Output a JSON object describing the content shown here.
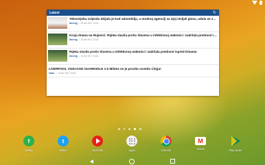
{
  "widget": {
    "title": "Latest",
    "items": [
      {
        "title": "Televizijska zvijezda Skijala je kod udomitelja, u modnoj agenciji za njoj stvljali glavu, adula se za grofa...",
        "source": "Dnevnjj",
        "time": "19 Avr 2017 13:24"
      },
      {
        "title": "Kroja drama na Rujevici: Rijeka slavila protiv Slavena u infektivnoj utakmici i zadržala prednost ispred Dinama",
        "source": "Dnevnjj",
        "time": "19 Avr 2017 13:24"
      },
      {
        "title": "Rijeka slavila protiv Slavena u infektivnoj utakmici i zadržala prednost ispred Dinama",
        "source": "Dnevnjj",
        "time": "19 Avr 2017 13:24"
      },
      {
        "title": "LIVERPOOL VODI KOD GUARDIOLE 1:0 Milnes se je proslio osvetio Cityju!",
        "source": "Index",
        "time": "19 Avr 2017 13:24"
      }
    ]
  },
  "dock": {
    "apps": [
      {
        "label": "feedly",
        "icon": "feedly-icon"
      },
      {
        "label": "Twitter",
        "icon": "twitter-icon"
      },
      {
        "label": "YouTube",
        "icon": "youtube-icon"
      },
      {
        "label": "Apps",
        "icon": "app-drawer-icon"
      },
      {
        "label": "Chrome",
        "icon": "chrome-icon"
      },
      {
        "label": "Gmail",
        "icon": "gmail-icon"
      },
      {
        "label": "Play Store",
        "icon": "play-store-icon"
      }
    ]
  },
  "colors": {
    "widget_header": "#1a4f8c",
    "wallpaper_start": "#c8600f",
    "wallpaper_end": "#6a9a2c"
  }
}
